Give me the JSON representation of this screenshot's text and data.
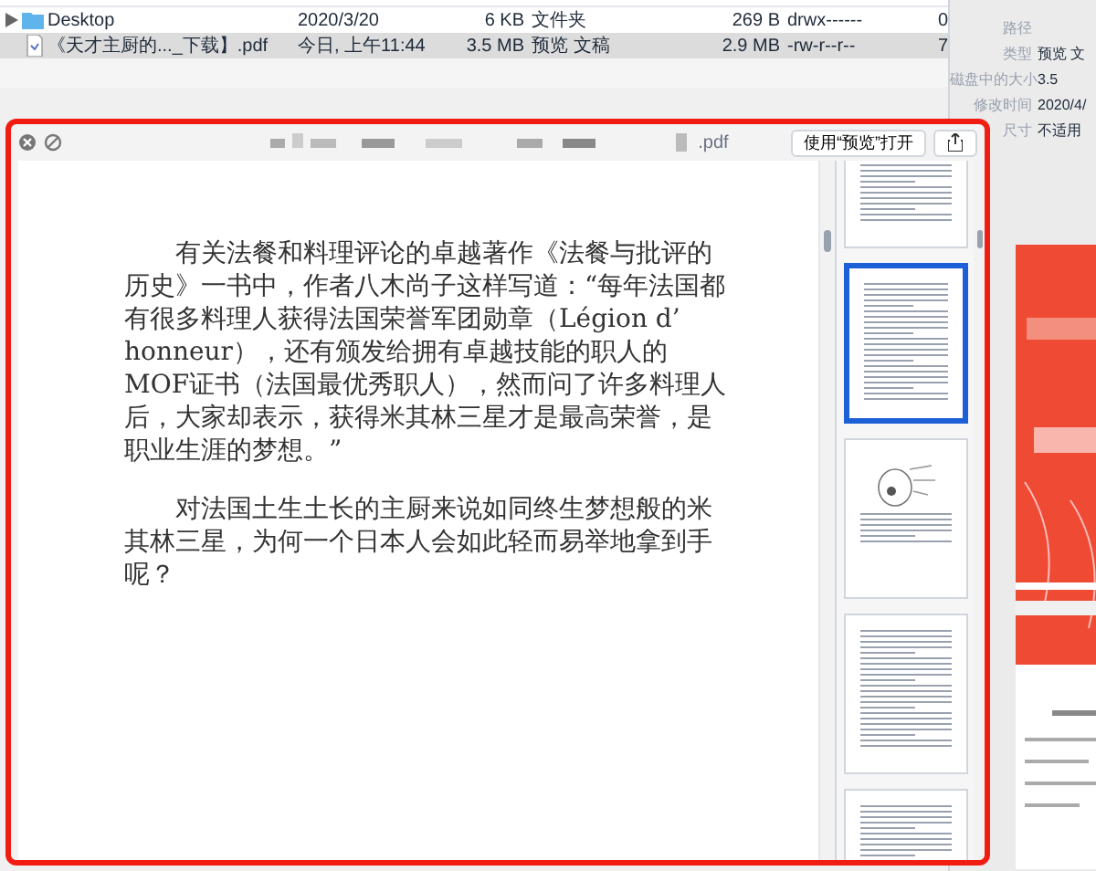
{
  "finder": {
    "rows": [
      {
        "name": "Desktop",
        "kind": "folder",
        "expanded": false,
        "selected": false,
        "date": "2020/3/20",
        "size": "6 KB",
        "type": "文件夹",
        "size_2": "269 B",
        "permissions": "drwx------",
        "count": "0"
      },
      {
        "name": "《天才主厨的..._下载】.pdf",
        "kind": "pdf",
        "selected": true,
        "date": "今日, 上午11:44",
        "size": "3.5 MB",
        "type": "预览 文稿",
        "size_2": "2.9 MB",
        "permissions": "-rw-r--r--",
        "count": "7"
      }
    ]
  },
  "inspector": {
    "fields": [
      {
        "label": "路径"
      },
      {
        "label": "类型",
        "value": "预览 文"
      },
      {
        "label": "磁盘中的大小",
        "value": "3.5"
      },
      {
        "label": "修改时间",
        "value": "2020/4/"
      },
      {
        "label": "尺寸",
        "value": "不适用"
      }
    ]
  },
  "quick_look": {
    "title_suffix": ".pdf",
    "open_button": "使用“预览”打开",
    "paragraphs": [
      "有关法餐和料理评论的卓越著作《法餐与批评的历史》一书中，作者八木尚子这样写道：“每年法国都有很多料理人获得法国荣誉军团勋章（Légion d’ honneur），还有颁发给拥有卓越技能的职人的MOF证书（法国最优秀职人），然而问了许多料理人后，大家却表示，获得米其林三星才是最高荣誉，是职业生涯的梦想。”",
      "对法国土生土长的主厨来说如同终生梦想般的米其林三星，为何一个日本人会如此轻而易举地拿到手呢？"
    ],
    "thumbnails": [
      {
        "kind": "text",
        "selected": false
      },
      {
        "kind": "text",
        "selected": true
      },
      {
        "kind": "illustration",
        "selected": false
      },
      {
        "kind": "text",
        "selected": false
      },
      {
        "kind": "text",
        "selected": false
      }
    ]
  }
}
